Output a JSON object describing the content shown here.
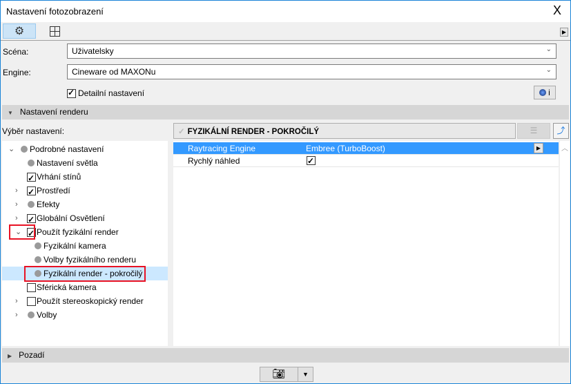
{
  "window": {
    "title": "Nastavení fotozobrazení",
    "close_icon": "X"
  },
  "toolbar": {
    "tabs": [
      {
        "icon": "gear-icon",
        "active": true
      },
      {
        "icon": "crop-frame-icon",
        "active": false
      }
    ]
  },
  "scene": {
    "label": "Scéna:",
    "value": "Uživatelsky"
  },
  "engine": {
    "label": "Engine:",
    "value": "Cineware od MAXONu"
  },
  "detail": {
    "label": "Detailní nastavení",
    "checked": true
  },
  "info_button": {
    "label": "i"
  },
  "render_section": {
    "label": "Nastavení renderu"
  },
  "preset": {
    "label": "Výběr nastavení:",
    "value": "FYZIKÁLNÍ RENDER - POKROČILÝ"
  },
  "tree": [
    {
      "label": "Podrobné nastavení",
      "level": 0,
      "expander": "open",
      "marker": "dot"
    },
    {
      "label": "Nastavení světla",
      "level": 1,
      "expander": "none",
      "marker": "dot"
    },
    {
      "label": "Vrhání stínů",
      "level": 1,
      "expander": "none",
      "marker": "checked"
    },
    {
      "label": "Prostředí",
      "level": 1,
      "expander": "closed",
      "marker": "checked"
    },
    {
      "label": "Efekty",
      "level": 1,
      "expander": "closed",
      "marker": "dot"
    },
    {
      "label": "Globální Osvětlení",
      "level": 1,
      "expander": "closed",
      "marker": "checked"
    },
    {
      "label": "Použít fyzikální render",
      "level": 1,
      "expander": "open",
      "marker": "checked"
    },
    {
      "label": "Fyzikální kamera",
      "level": 2,
      "expander": "none",
      "marker": "dot"
    },
    {
      "label": "Volby fyzikálního renderu",
      "level": 2,
      "expander": "none",
      "marker": "dot"
    },
    {
      "label": "Fyzikální render - pokročilý",
      "level": 2,
      "expander": "none",
      "marker": "dot",
      "selected": true
    },
    {
      "label": "Sférická kamera",
      "level": 1,
      "expander": "none",
      "marker": "unchecked"
    },
    {
      "label": "Použít stereoskopický render",
      "level": 1,
      "expander": "closed",
      "marker": "unchecked"
    },
    {
      "label": "Volby",
      "level": 1,
      "expander": "closed",
      "marker": "dot"
    }
  ],
  "properties": [
    {
      "name": "Raytracing Engine",
      "value": "Embree (TurboBoost)",
      "selected": true
    },
    {
      "name": "Rychlý náhled",
      "value": "",
      "checked": true
    }
  ],
  "background_section": {
    "label": "Pozadí"
  },
  "colors": {
    "selection": "#3399ff",
    "tree_selection": "#cce8ff",
    "highlight": "#e81123"
  }
}
